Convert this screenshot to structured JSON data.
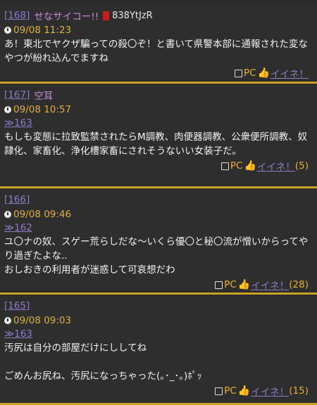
{
  "posts": [
    {
      "number": "[168]",
      "name": "せなサイコー!!",
      "trip": "838YtJzR",
      "time": "09/08 11:23",
      "reply": "",
      "body": "あ！東北でヤクザ騙っての殺〇ぞ！と書いて県警本部に通報された変なやつが紛れ込んでますね",
      "device": "PC",
      "like": "イイネ！",
      "count": ""
    },
    {
      "number": "[167]",
      "name": "空耳",
      "trip": "",
      "time": "09/08 10:57",
      "reply": "≫163",
      "body": "もしも変態に拉致監禁されたらM調教、肉便器調教、公衆便所調教、奴隷化、家畜化、浄化槽家畜にされそうないい女装子だ。",
      "device": "PC",
      "like": "イイネ！",
      "count": "(5)"
    },
    {
      "number": "[166]",
      "name": "",
      "trip": "",
      "time": "09/08 09:46",
      "reply": "≫162",
      "body": "ユ〇ナの奴、スゲー荒らしだな〜いくら優〇と秘〇流が憎いからってやり過ぎたよな..\nおしおきの利用者が迷惑して可哀想だわ",
      "device": "PC",
      "like": "イイネ！",
      "count": "(28)"
    },
    {
      "number": "[165]",
      "name": "",
      "trip": "",
      "time": "09/08 09:03",
      "reply": "≫163",
      "body": "汚尻は自分の部屋だけにししてね\n\nごめんお尻ね、汚尻になっちゃった(｡･_･｡)ﾎﾟｯ",
      "device": "PC",
      "like": "イイネ！",
      "count": "(15)"
    }
  ]
}
